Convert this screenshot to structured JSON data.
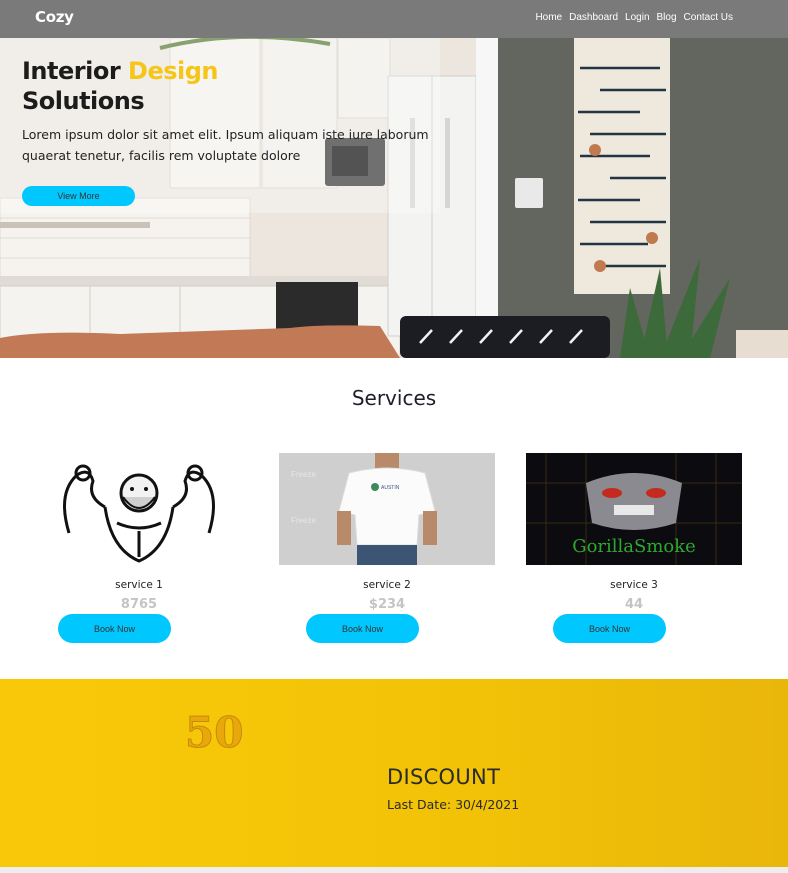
{
  "nav": {
    "brand": "Cozy",
    "links": [
      "Home",
      "Dashboard",
      "Login",
      "Blog",
      "Contact Us"
    ]
  },
  "hero": {
    "title_part1": "Interior ",
    "title_accent": "Design",
    "title_part2": "Solutions",
    "description": "Lorem ipsum dolor sit amet elit. Ipsum aliquam iste iure laborum quaerat tenetur, facilis rem voluptate dolore",
    "button_label": "View More"
  },
  "services": {
    "title": "Services",
    "items": [
      {
        "name": "service 1",
        "price": "8765",
        "button": "Book Now"
      },
      {
        "name": "service 2",
        "price": "$234",
        "button": "Book Now"
      },
      {
        "name": "service 3",
        "price": "44",
        "button": "Book Now"
      }
    ],
    "image_text": {
      "shirt_watermark": "Freeze",
      "shirt_logo": "AUSTIN",
      "gorilla_logo": "GorillaSmoke"
    }
  },
  "discount": {
    "title": "DISCOUNT",
    "date": "Last Date: 30/4/2021",
    "badge": "50"
  },
  "colors": {
    "navbar": "#7a7a7a",
    "accent_yellow": "#f5c518",
    "button_cyan": "#00c8ff",
    "discount_bg": "#f4c308"
  }
}
